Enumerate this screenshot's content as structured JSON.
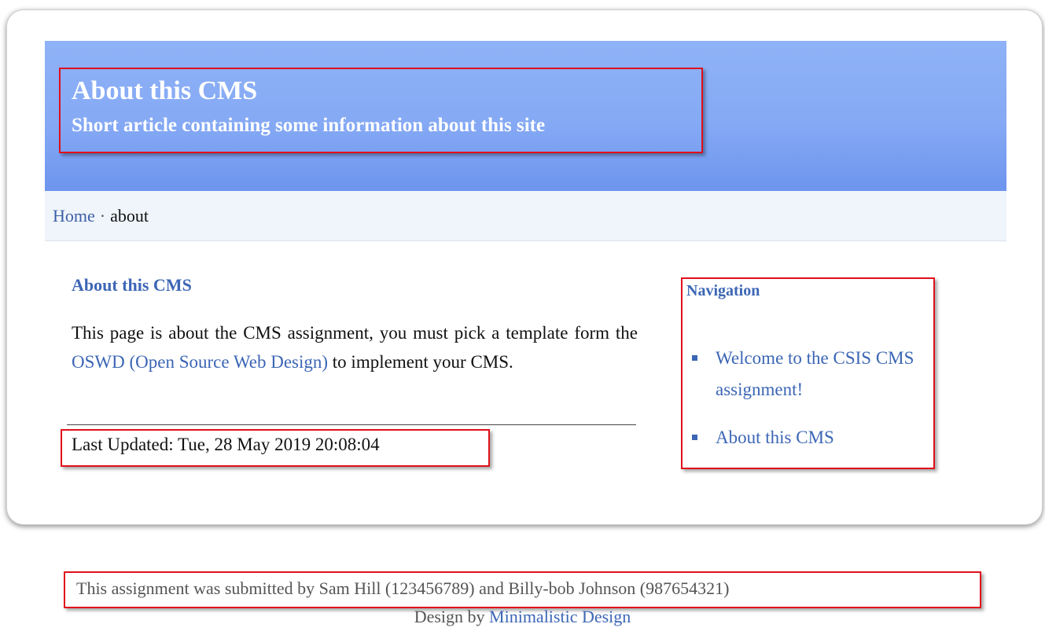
{
  "header": {
    "title": "About this CMS",
    "subtitle": "Short article containing some information about this site"
  },
  "breadcrumb": {
    "home_label": "Home",
    "separator": "·",
    "current": "about"
  },
  "article": {
    "title": "About this CMS",
    "text_before_link": "This page is about the CMS assignment, you must pick a template form the ",
    "link_label": "OSWD (Open Source Web Design)",
    "text_after_link": " to implement your CMS.",
    "last_updated": "Last Updated: Tue, 28 May 2019 20:08:04"
  },
  "navigation": {
    "title": "Navigation",
    "items": [
      {
        "label": "Welcome to the CSIS CMS assignment!"
      },
      {
        "label": "About this CMS"
      }
    ]
  },
  "footer": {
    "submitted_text": "This assignment was submitted by Sam Hill (123456789) and Billy-bob Johnson (987654321)",
    "design_prefix": "Design by ",
    "design_link": "Minimalistic Design"
  },
  "colors": {
    "banner": "#85a9f4",
    "link": "#3c66b5",
    "highlight_border": "#e0101c"
  }
}
